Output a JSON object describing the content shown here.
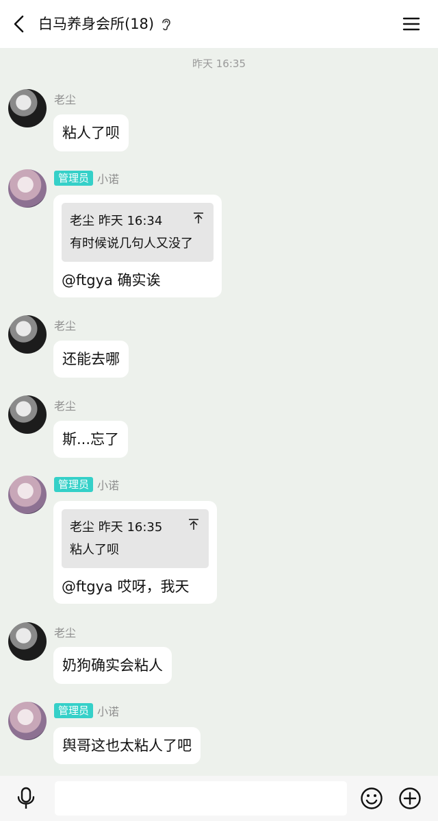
{
  "header": {
    "title": "白马养身会所(18)",
    "back_icon": "chevron-left-icon",
    "ear_icon": "ear-icon",
    "menu_icon": "hamburger-menu-icon"
  },
  "timestamp": "昨天 16:35",
  "messages": [
    {
      "sender": "老尘",
      "text": "粘人了呗"
    },
    {
      "sender": "小诺",
      "badge": "管理员",
      "quote": {
        "meta": "老尘 昨天 16:34",
        "text": "有时候说几句人又没了"
      },
      "text": "@ftgya 确实诶"
    },
    {
      "sender": "老尘",
      "text": "还能去哪"
    },
    {
      "sender": "老尘",
      "text": "斯...忘了"
    },
    {
      "sender": "小诺",
      "badge": "管理员",
      "quote": {
        "meta": "老尘 昨天 16:35",
        "text": "粘人了呗"
      },
      "text": "@ftgya 哎呀，我天"
    },
    {
      "sender": "老尘",
      "text": "奶狗确实会粘人"
    },
    {
      "sender": "小诺",
      "badge": "管理员",
      "text": "舆哥这也太粘人了吧"
    }
  ],
  "footer": {
    "input_value": "",
    "voice_icon": "microphone-icon",
    "emoji_icon": "emoji-icon",
    "plus_icon": "plus-circle-icon"
  },
  "colors": {
    "background": "#edf1ec",
    "badge": "#35d0c8",
    "bubble": "#ffffff"
  }
}
